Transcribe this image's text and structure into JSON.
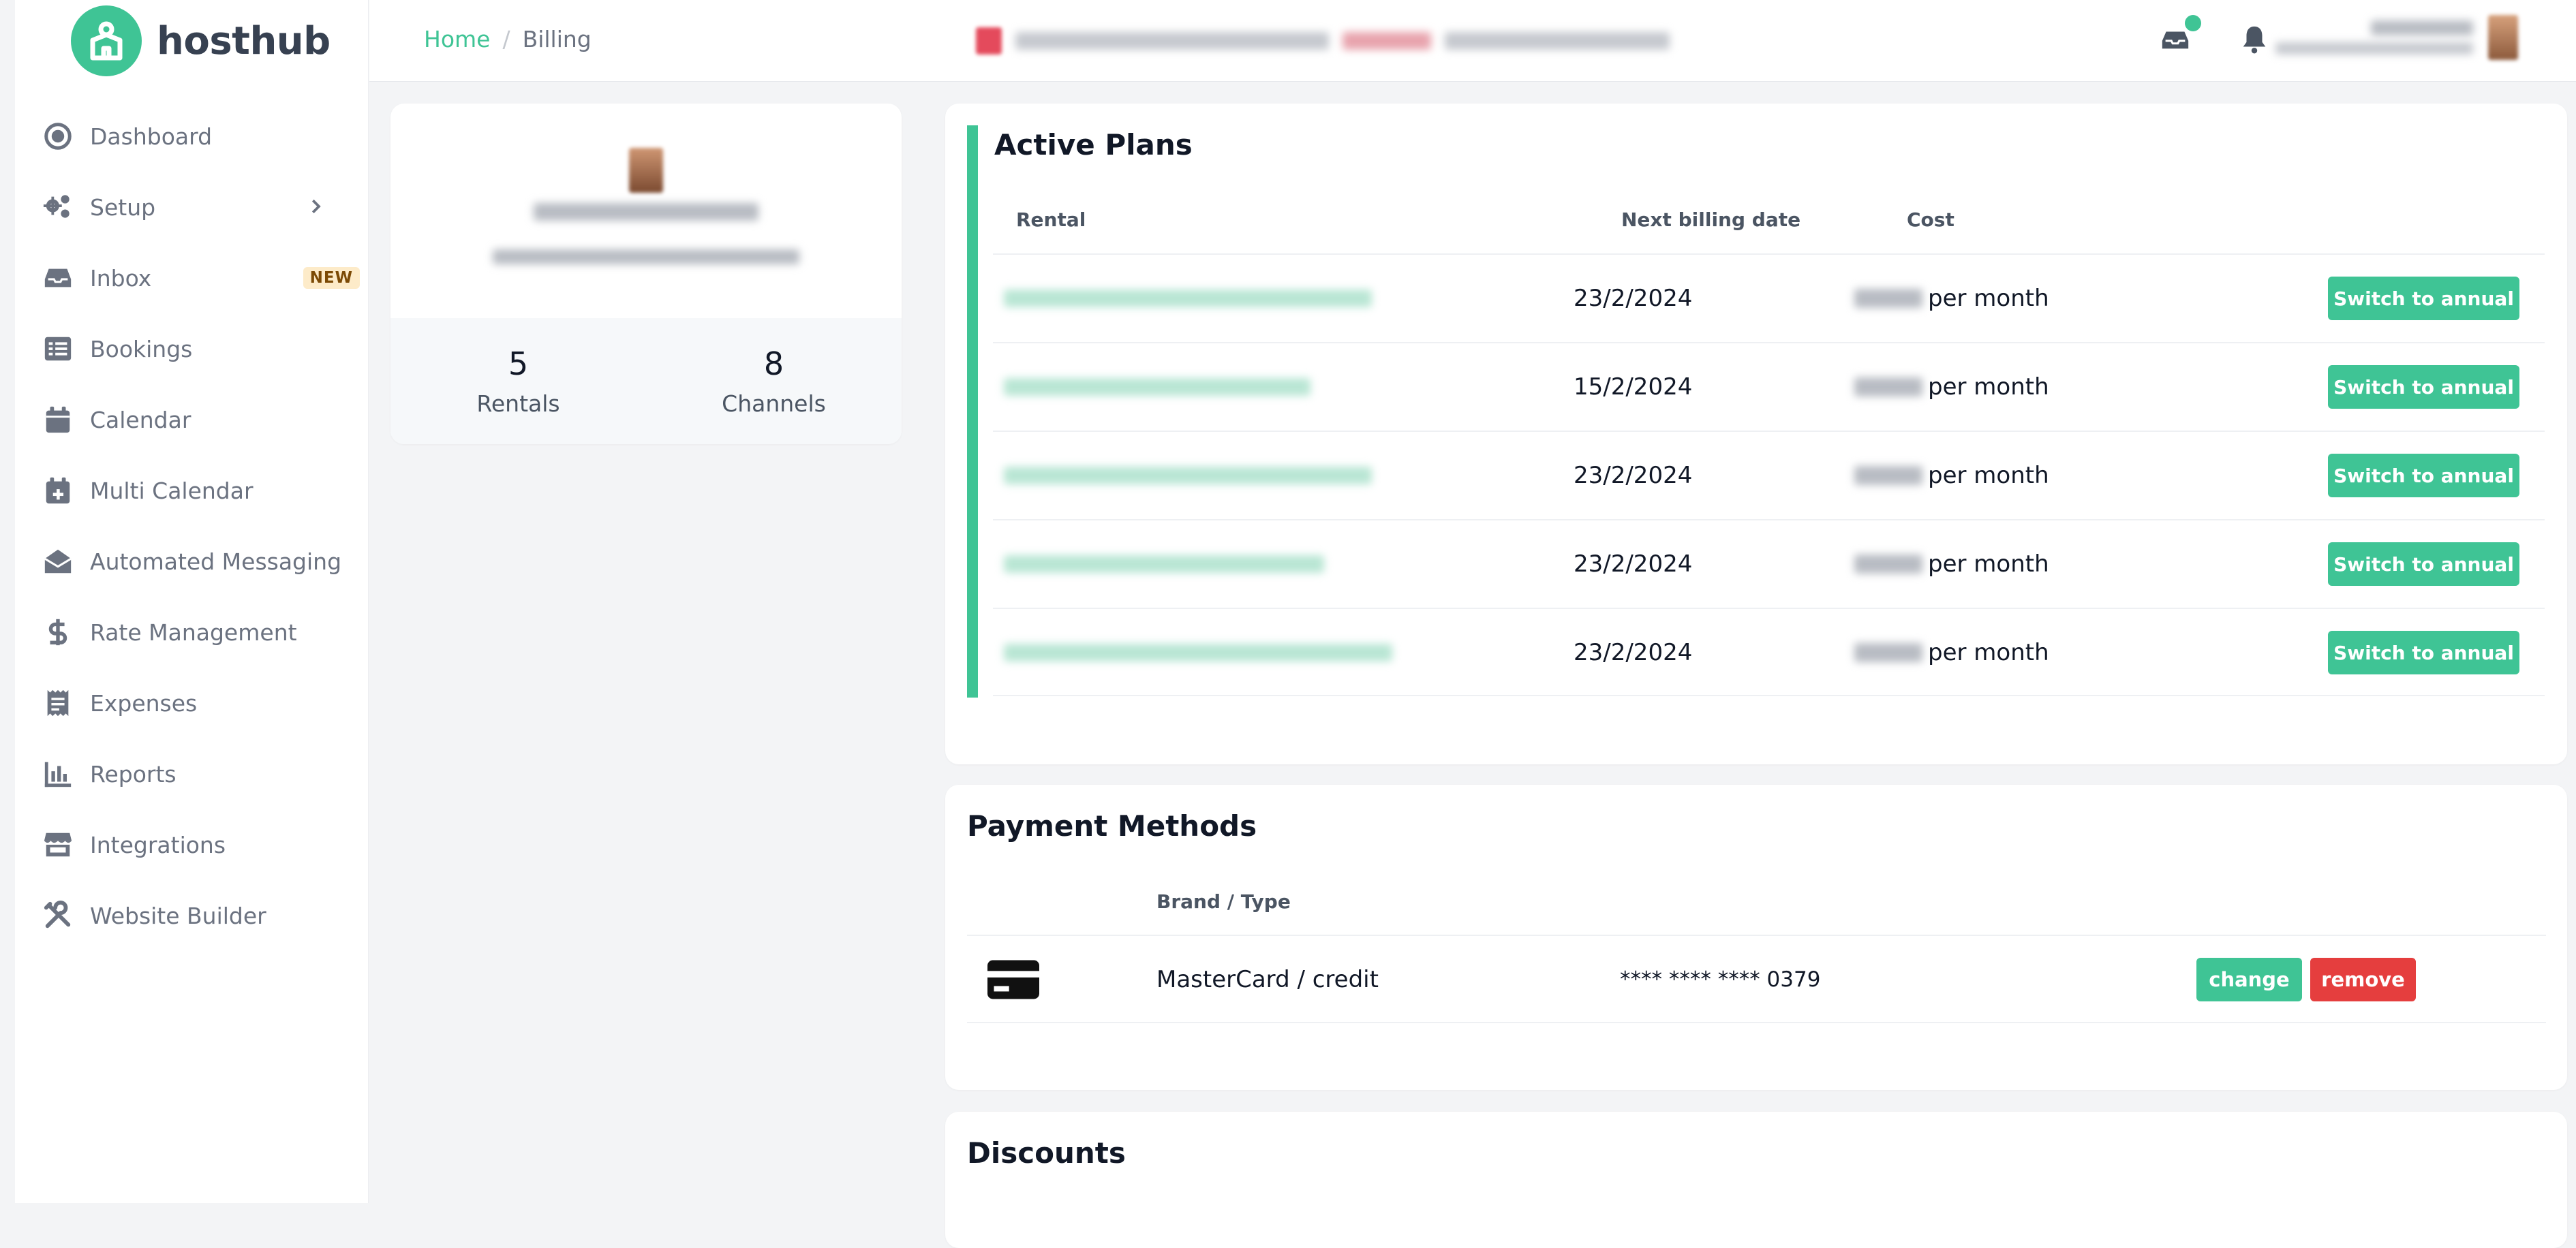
{
  "brand": {
    "name": "hosthub",
    "color": "#3fc495"
  },
  "sidebar": {
    "items": [
      {
        "label": "Dashboard",
        "icon": "dashboard-icon"
      },
      {
        "label": "Setup",
        "icon": "gears-icon",
        "has_submenu": true
      },
      {
        "label": "Inbox",
        "icon": "inbox-icon",
        "badge": "NEW"
      },
      {
        "label": "Bookings",
        "icon": "list-icon"
      },
      {
        "label": "Calendar",
        "icon": "calendar-icon"
      },
      {
        "label": "Multi Calendar",
        "icon": "calendar-plus-icon"
      },
      {
        "label": "Automated Messaging",
        "icon": "envelope-open-icon"
      },
      {
        "label": "Rate Management",
        "icon": "dollar-icon"
      },
      {
        "label": "Expenses",
        "icon": "receipt-icon"
      },
      {
        "label": "Reports",
        "icon": "bar-chart-icon"
      },
      {
        "label": "Integrations",
        "icon": "store-icon"
      },
      {
        "label": "Website Builder",
        "icon": "tools-icon"
      }
    ]
  },
  "breadcrumb": {
    "home": "Home",
    "separator": "/",
    "current": "Billing"
  },
  "profile": {
    "stats": [
      {
        "value": "5",
        "label": "Rentals"
      },
      {
        "value": "8",
        "label": "Channels"
      }
    ]
  },
  "active_plans": {
    "title": "Active Plans",
    "columns": {
      "rental": "Rental",
      "next_billing": "Next billing date",
      "cost": "Cost"
    },
    "rows": [
      {
        "next_billing": "23/2/2024",
        "cost_suffix": "per month",
        "action": "Switch to annual"
      },
      {
        "next_billing": "15/2/2024",
        "cost_suffix": "per month",
        "action": "Switch to annual"
      },
      {
        "next_billing": "23/2/2024",
        "cost_suffix": "per month",
        "action": "Switch to annual"
      },
      {
        "next_billing": "23/2/2024",
        "cost_suffix": "per month",
        "action": "Switch to annual"
      },
      {
        "next_billing": "23/2/2024",
        "cost_suffix": "per month",
        "action": "Switch to annual"
      }
    ]
  },
  "payment_methods": {
    "title": "Payment Methods",
    "columns": {
      "brand": "Brand / Type"
    },
    "rows": [
      {
        "icon": "credit-card-icon",
        "brand": "MasterCard / credit",
        "number": "**** **** **** 0379",
        "change": "change",
        "remove": "remove"
      }
    ]
  },
  "discounts": {
    "title": "Discounts"
  }
}
